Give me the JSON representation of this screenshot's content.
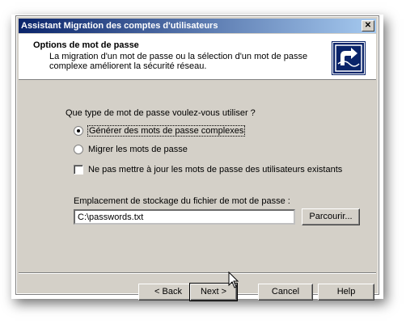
{
  "window": {
    "title": "Assistant Migration des comptes d'utilisateurs",
    "close_glyph": "✕"
  },
  "header": {
    "title": "Options de mot de passe",
    "description": "La migration d'un mot de passe ou la sélection d'un mot de passe complexe améliorent la sécurité réseau.",
    "logo_icon": "migration-wizard-icon"
  },
  "question": "Que type de mot de passe voulez-vous utiliser ?",
  "options": {
    "generate": {
      "label": "Générer des mots de passe complexes",
      "checked": true
    },
    "migrate": {
      "label": "Migrer les mots de passe",
      "checked": false
    },
    "no_update": {
      "label": "Ne pas mettre à jour les mots de passe des utilisateurs existants",
      "checked": false
    }
  },
  "storage": {
    "label": "Emplacement de stockage du fichier de mot de passe :",
    "value": "C:\\passwords.txt",
    "browse_label": "Parcourir..."
  },
  "buttons": {
    "back": "< Back",
    "next": "Next >",
    "cancel": "Cancel",
    "help": "Help"
  },
  "colors": {
    "title_start": "#0a246a",
    "title_end": "#a6caf0",
    "face": "#d4d0c8"
  }
}
